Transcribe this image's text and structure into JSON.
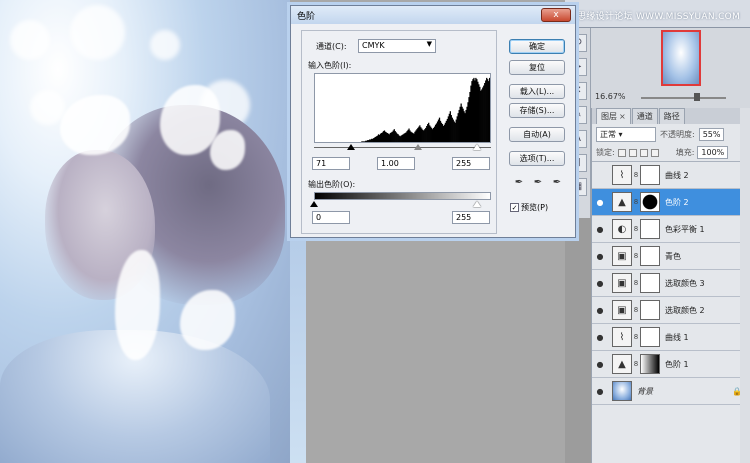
{
  "watermark": "思缘设计论坛  WWW.MISSYUAN.COM",
  "navigator": {
    "zoom": "16.67%"
  },
  "layers_panel": {
    "tabs": [
      "图层",
      "通道",
      "路径"
    ],
    "blend_mode": "正常",
    "opacity_label": "不透明度:",
    "opacity_value": "55%",
    "lock_label": "锁定:",
    "fill_label": "填充:",
    "fill_value": "100%",
    "layers": [
      {
        "name": "曲线 2",
        "visible": false,
        "thumb": "curves-icon",
        "selected": false
      },
      {
        "name": "色阶 2",
        "visible": true,
        "thumb": "levels-icon",
        "selected": true
      },
      {
        "name": "色彩平衡 1",
        "visible": true,
        "thumb": "color-balance-icon",
        "selected": false
      },
      {
        "name": "青色",
        "visible": true,
        "thumb": "adjustment-icon",
        "selected": false
      },
      {
        "name": "选取颜色 3",
        "visible": true,
        "thumb": "adjustment-icon",
        "selected": false
      },
      {
        "name": "选取颜色 2",
        "visible": true,
        "thumb": "adjustment-icon",
        "selected": false
      },
      {
        "name": "曲线 1",
        "visible": true,
        "thumb": "curves-icon",
        "selected": false
      },
      {
        "name": "色阶 1",
        "visible": true,
        "thumb": "levels-icon",
        "selected": false
      },
      {
        "name": "背景",
        "visible": true,
        "thumb": "photo",
        "selected": false
      }
    ]
  },
  "dialog": {
    "title": "色阶",
    "close": "x",
    "channel_label": "通道(C):",
    "channel_value": "CMYK",
    "input_label": "输入色阶(I):",
    "input_black": "71",
    "input_gamma": "1.00",
    "input_white": "255",
    "output_label": "输出色阶(O):",
    "output_black": "0",
    "output_white": "255",
    "buttons": {
      "ok": "确定",
      "reset": "复位",
      "load": "载入(L)...",
      "save": "存储(S)...",
      "auto": "自动(A)",
      "options": "选项(T)..."
    },
    "preview_label": "预览(P)",
    "preview_checked": true,
    "histogram": [
      0,
      0,
      0,
      0,
      0,
      0,
      0,
      0,
      0,
      0,
      0,
      0,
      0,
      0,
      0,
      0,
      0,
      0,
      0,
      0,
      0,
      0,
      0,
      0,
      0,
      0,
      0,
      0,
      0,
      0,
      0,
      0,
      0,
      0,
      0,
      0,
      0,
      0,
      0,
      0,
      0,
      0,
      0,
      0,
      0,
      0,
      0,
      1,
      1,
      1,
      1,
      2,
      2,
      3,
      3,
      4,
      4,
      5,
      5,
      6,
      7,
      8,
      9,
      10,
      12,
      11,
      13,
      14,
      15,
      17,
      18,
      16,
      15,
      14,
      13,
      12,
      14,
      15,
      16,
      18,
      20,
      17,
      15,
      13,
      12,
      10,
      9,
      10,
      11,
      12,
      13,
      14,
      15,
      17,
      19,
      21,
      18,
      16,
      15,
      14,
      13,
      16,
      18,
      20,
      22,
      24,
      26,
      23,
      21,
      19,
      18,
      20,
      22,
      25,
      28,
      30,
      26,
      24,
      22,
      20,
      22,
      24,
      27,
      29,
      32,
      35,
      38,
      33,
      30,
      28,
      25,
      27,
      30,
      33,
      36,
      40,
      44,
      48,
      42,
      38,
      35,
      32,
      30,
      35,
      40,
      45,
      50,
      55,
      60,
      55,
      52,
      48,
      45,
      50,
      55,
      62,
      70,
      78,
      88,
      95,
      98,
      100,
      96,
      100,
      98,
      94,
      90,
      86,
      80,
      82,
      85,
      88,
      92,
      96,
      100,
      98,
      95,
      100
    ]
  }
}
